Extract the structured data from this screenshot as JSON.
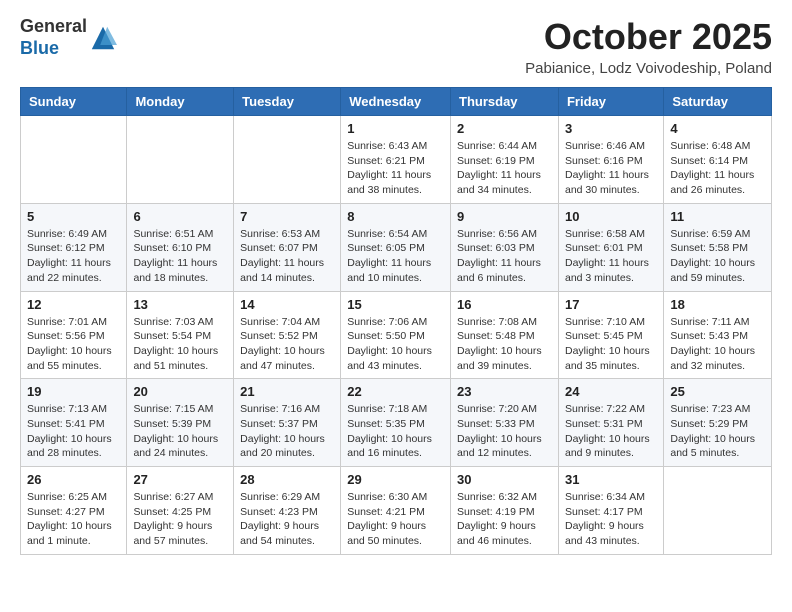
{
  "logo": {
    "line1": "General",
    "line2": "Blue"
  },
  "header": {
    "title": "October 2025",
    "subtitle": "Pabianice, Lodz Voivodeship, Poland"
  },
  "weekdays": [
    "Sunday",
    "Monday",
    "Tuesday",
    "Wednesday",
    "Thursday",
    "Friday",
    "Saturday"
  ],
  "weeks": [
    [
      {
        "day": "",
        "info": ""
      },
      {
        "day": "",
        "info": ""
      },
      {
        "day": "",
        "info": ""
      },
      {
        "day": "1",
        "info": "Sunrise: 6:43 AM\nSunset: 6:21 PM\nDaylight: 11 hours\nand 38 minutes."
      },
      {
        "day": "2",
        "info": "Sunrise: 6:44 AM\nSunset: 6:19 PM\nDaylight: 11 hours\nand 34 minutes."
      },
      {
        "day": "3",
        "info": "Sunrise: 6:46 AM\nSunset: 6:16 PM\nDaylight: 11 hours\nand 30 minutes."
      },
      {
        "day": "4",
        "info": "Sunrise: 6:48 AM\nSunset: 6:14 PM\nDaylight: 11 hours\nand 26 minutes."
      }
    ],
    [
      {
        "day": "5",
        "info": "Sunrise: 6:49 AM\nSunset: 6:12 PM\nDaylight: 11 hours\nand 22 minutes."
      },
      {
        "day": "6",
        "info": "Sunrise: 6:51 AM\nSunset: 6:10 PM\nDaylight: 11 hours\nand 18 minutes."
      },
      {
        "day": "7",
        "info": "Sunrise: 6:53 AM\nSunset: 6:07 PM\nDaylight: 11 hours\nand 14 minutes."
      },
      {
        "day": "8",
        "info": "Sunrise: 6:54 AM\nSunset: 6:05 PM\nDaylight: 11 hours\nand 10 minutes."
      },
      {
        "day": "9",
        "info": "Sunrise: 6:56 AM\nSunset: 6:03 PM\nDaylight: 11 hours\nand 6 minutes."
      },
      {
        "day": "10",
        "info": "Sunrise: 6:58 AM\nSunset: 6:01 PM\nDaylight: 11 hours\nand 3 minutes."
      },
      {
        "day": "11",
        "info": "Sunrise: 6:59 AM\nSunset: 5:58 PM\nDaylight: 10 hours\nand 59 minutes."
      }
    ],
    [
      {
        "day": "12",
        "info": "Sunrise: 7:01 AM\nSunset: 5:56 PM\nDaylight: 10 hours\nand 55 minutes."
      },
      {
        "day": "13",
        "info": "Sunrise: 7:03 AM\nSunset: 5:54 PM\nDaylight: 10 hours\nand 51 minutes."
      },
      {
        "day": "14",
        "info": "Sunrise: 7:04 AM\nSunset: 5:52 PM\nDaylight: 10 hours\nand 47 minutes."
      },
      {
        "day": "15",
        "info": "Sunrise: 7:06 AM\nSunset: 5:50 PM\nDaylight: 10 hours\nand 43 minutes."
      },
      {
        "day": "16",
        "info": "Sunrise: 7:08 AM\nSunset: 5:48 PM\nDaylight: 10 hours\nand 39 minutes."
      },
      {
        "day": "17",
        "info": "Sunrise: 7:10 AM\nSunset: 5:45 PM\nDaylight: 10 hours\nand 35 minutes."
      },
      {
        "day": "18",
        "info": "Sunrise: 7:11 AM\nSunset: 5:43 PM\nDaylight: 10 hours\nand 32 minutes."
      }
    ],
    [
      {
        "day": "19",
        "info": "Sunrise: 7:13 AM\nSunset: 5:41 PM\nDaylight: 10 hours\nand 28 minutes."
      },
      {
        "day": "20",
        "info": "Sunrise: 7:15 AM\nSunset: 5:39 PM\nDaylight: 10 hours\nand 24 minutes."
      },
      {
        "day": "21",
        "info": "Sunrise: 7:16 AM\nSunset: 5:37 PM\nDaylight: 10 hours\nand 20 minutes."
      },
      {
        "day": "22",
        "info": "Sunrise: 7:18 AM\nSunset: 5:35 PM\nDaylight: 10 hours\nand 16 minutes."
      },
      {
        "day": "23",
        "info": "Sunrise: 7:20 AM\nSunset: 5:33 PM\nDaylight: 10 hours\nand 12 minutes."
      },
      {
        "day": "24",
        "info": "Sunrise: 7:22 AM\nSunset: 5:31 PM\nDaylight: 10 hours\nand 9 minutes."
      },
      {
        "day": "25",
        "info": "Sunrise: 7:23 AM\nSunset: 5:29 PM\nDaylight: 10 hours\nand 5 minutes."
      }
    ],
    [
      {
        "day": "26",
        "info": "Sunrise: 6:25 AM\nSunset: 4:27 PM\nDaylight: 10 hours\nand 1 minute."
      },
      {
        "day": "27",
        "info": "Sunrise: 6:27 AM\nSunset: 4:25 PM\nDaylight: 9 hours\nand 57 minutes."
      },
      {
        "day": "28",
        "info": "Sunrise: 6:29 AM\nSunset: 4:23 PM\nDaylight: 9 hours\nand 54 minutes."
      },
      {
        "day": "29",
        "info": "Sunrise: 6:30 AM\nSunset: 4:21 PM\nDaylight: 9 hours\nand 50 minutes."
      },
      {
        "day": "30",
        "info": "Sunrise: 6:32 AM\nSunset: 4:19 PM\nDaylight: 9 hours\nand 46 minutes."
      },
      {
        "day": "31",
        "info": "Sunrise: 6:34 AM\nSunset: 4:17 PM\nDaylight: 9 hours\nand 43 minutes."
      },
      {
        "day": "",
        "info": ""
      }
    ]
  ]
}
